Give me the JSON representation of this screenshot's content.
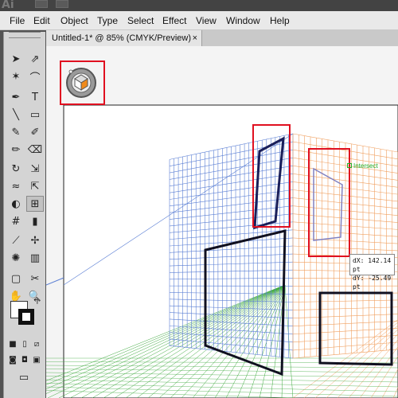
{
  "app": {
    "logo": "Ai"
  },
  "menubar": {
    "items": [
      "File",
      "Edit",
      "Object",
      "Type",
      "Select",
      "Effect",
      "View",
      "Window",
      "Help"
    ]
  },
  "document": {
    "tab_title": "Untitled-1* @ 85% (CMYK/Preview)",
    "close_glyph": "×"
  },
  "canvas": {
    "intersect_label": "Intersect",
    "tooltip": {
      "dx": "dX: 142.14 pt",
      "dy": "dY: -25.49 pt"
    }
  },
  "colors": {
    "left_grid": "#5b7fd4",
    "right_grid": "#f0a060",
    "ground_grid": "#3faa3f",
    "highlight": "#e01020",
    "rect_stroke": "#101020"
  },
  "tools": {
    "icons": [
      "selection-icon",
      "direct-selection-icon",
      "magic-wand-icon",
      "lasso-icon",
      "pen-icon",
      "type-icon",
      "line-segment-icon",
      "rectangle-icon",
      "paintbrush-icon",
      "pencil-icon",
      "blob-brush-icon",
      "eraser-icon",
      "rotate-icon",
      "scale-icon",
      "warp-icon",
      "free-transform-icon",
      "shape-builder-icon",
      "perspective-grid-icon",
      "mesh-icon",
      "gradient-icon",
      "eyedropper-icon",
      "blend-icon",
      "symbol-sprayer-icon",
      "column-graph-icon",
      "artboard-icon",
      "slice-icon",
      "hand-icon",
      "zoom-icon"
    ],
    "glyphs": [
      "➤",
      "⇗",
      "✶",
      "⌒",
      "✒",
      "T",
      "╲",
      "▭",
      "✎",
      "✐",
      "✏",
      "⌫",
      "↻",
      "⇲",
      "≈",
      "⇱",
      "◐",
      "⊞",
      "#",
      "▮",
      "⟋",
      "✢",
      "✺",
      "▥",
      "▢",
      "✂",
      "✋",
      "🔍"
    ]
  }
}
